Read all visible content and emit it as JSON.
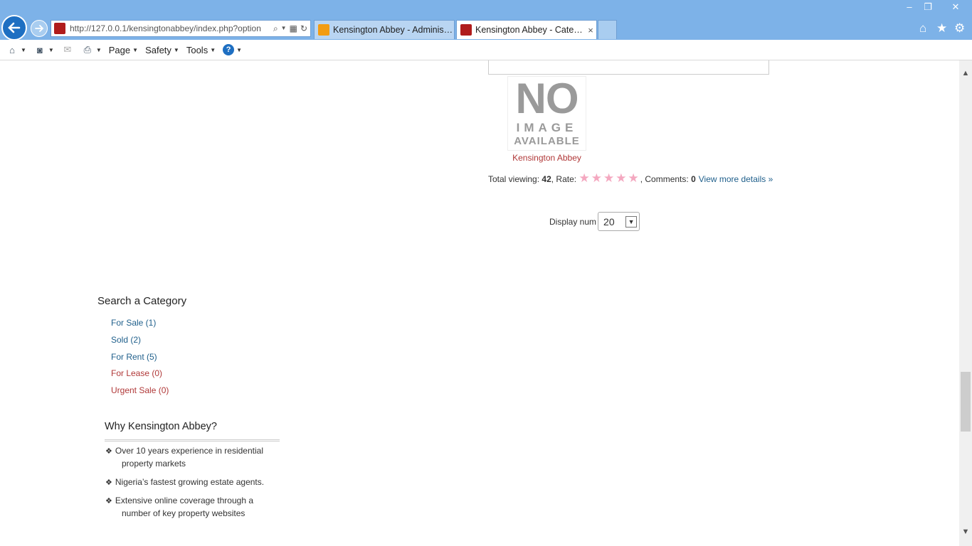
{
  "browser": {
    "url": "http://127.0.0.1/kensingtonabbey/index.php?option",
    "tabs": [
      {
        "label": "Kensington Abbey - Administr...",
        "active": false
      },
      {
        "label": "Kensington Abbey - Catego...",
        "active": true
      }
    ],
    "tab_close": "×",
    "window_controls": {
      "minimize": "–",
      "restore": "❐",
      "close": "✕"
    },
    "right_icons": {
      "home": "⌂",
      "favorites": "★",
      "settings": "⚙"
    }
  },
  "commandbar": {
    "page": "Page",
    "safety": "Safety",
    "tools": "Tools",
    "help": "?"
  },
  "listing": {
    "name": "Kensington Abbey",
    "no_image": {
      "line1": "NO",
      "line2": "IMAGE",
      "line3": "AVAILABLE"
    },
    "total_viewing_label": "Total viewing:",
    "total_viewing_value": "42",
    "rate_label": ", Rate:",
    "rating_stars": 5,
    "comments_label": ", Comments:",
    "comments_value": "0",
    "view_more": "View more details »"
  },
  "pagination": {
    "display_label": "Display num",
    "display_value": "20"
  },
  "sidebar": {
    "search_title": "Search a Category",
    "categories": [
      {
        "label": "For Sale (1)",
        "color": "#1f5f8b"
      },
      {
        "label": "Sold (2)",
        "color": "#1f5f8b"
      },
      {
        "label": "For Rent (5)",
        "color": "#1f5f8b"
      },
      {
        "label": "For Lease (0)",
        "color": "#b03838"
      },
      {
        "label": "Urgent Sale (0)",
        "color": "#b03838"
      }
    ],
    "why_title": "Why Kensington Abbey?",
    "why_items": [
      {
        "line1": "Over 10 years experience in residential",
        "line2": "property markets"
      },
      {
        "line1": "Nigeria’s fastest growing estate agents.",
        "line2": ""
      },
      {
        "line1": "Extensive online coverage through a",
        "line2": "number of key property websites"
      }
    ]
  },
  "colors": {
    "chrome": "#7db2e8",
    "link": "#1f5f8b",
    "accent_red": "#b03838",
    "star": "#f4a8c0"
  }
}
